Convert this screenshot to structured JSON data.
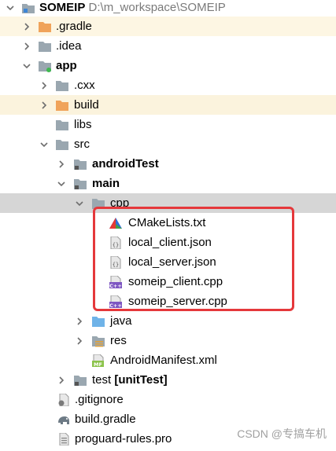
{
  "project": {
    "name": "SOMEIP",
    "path": "D:\\m_workspace\\SOMEIP"
  },
  "items": [
    {
      "label": ".gradle",
      "icon": "folder-orange"
    },
    {
      "label": ".idea",
      "icon": "folder-gray"
    },
    {
      "label": "app",
      "icon": "module-folder"
    },
    {
      "label": ".cxx",
      "icon": "folder-gray"
    },
    {
      "label": "build",
      "icon": "folder-orange"
    },
    {
      "label": "libs",
      "icon": "folder-gray"
    },
    {
      "label": "src",
      "icon": "folder-gray"
    },
    {
      "label": "androidTest",
      "icon": "source-folder"
    },
    {
      "label": "main",
      "icon": "source-folder"
    },
    {
      "label": "cpp",
      "icon": "folder-gray"
    },
    {
      "label": "CMakeLists.txt",
      "icon": "cmake-icon"
    },
    {
      "label": "local_client.json",
      "icon": "json-icon"
    },
    {
      "label": "local_server.json",
      "icon": "json-icon"
    },
    {
      "label": "someip_client.cpp",
      "icon": "cpp-icon"
    },
    {
      "label": "someip_server.cpp",
      "icon": "cpp-icon"
    },
    {
      "label": "java",
      "icon": "folder-blue"
    },
    {
      "label": "res",
      "icon": "res-folder"
    },
    {
      "label": "AndroidManifest.xml",
      "icon": "manifest-icon"
    },
    {
      "label": "test",
      "suffix": "[unitTest]",
      "icon": "source-folder"
    },
    {
      "label": ".gitignore",
      "icon": "gitignore-icon"
    },
    {
      "label": "build.gradle",
      "icon": "gradle-icon"
    },
    {
      "label": "proguard-rules.pro",
      "icon": "file-icon"
    }
  ],
  "watermark": "CSDN @专搞车机",
  "colors": {
    "highlight_border": "#e5383b",
    "selected_row": "#d6d6d6"
  }
}
